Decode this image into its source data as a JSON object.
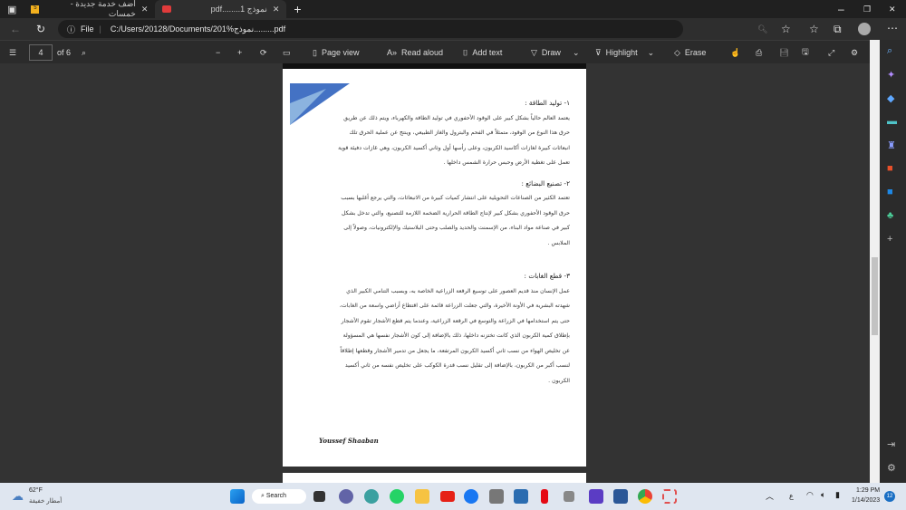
{
  "tabs": [
    {
      "label": "أضف خدمة جديدة - خمسات",
      "icon": "khamsat-icon"
    },
    {
      "label": "pdf........نموذج 1",
      "icon": "pdf-icon"
    }
  ],
  "address": {
    "scheme": "File",
    "url": "C:/Users/20128/Documents/201%نموذج.........pdf"
  },
  "pdf_toolbar": {
    "page": "4",
    "of": "of 6",
    "page_view": "Page view",
    "read_aloud": "Read aloud",
    "add_text": "Add text",
    "draw": "Draw",
    "highlight": "Highlight",
    "erase": "Erase"
  },
  "document": {
    "s1_title": "١- توليد الطاقة :",
    "s1_lines": [
      "يعتمد العالم حالياً بشكل كبير على الوقود الأحفوري في توليد الطاقة والكهرباء، ويتم ذلك عن طريق",
      "حرق هذا النوع من الوقود، متمثلاً في الفحم والبترول والغاز الطبيعي، وينتج عن عملية الحرق تلك",
      "انبعاثات كبيرة لغازات أكاسيد الكربون، وعلى رأسها أول وثاني أكسيد الكربون، وهي غازات دفيئة قوية",
      "تعمل على تغطية الأرض وحبس حرارة الشمس داخلها ."
    ],
    "s2_title": "٢- تصنيع البضائع :",
    "s2_lines": [
      "تعتمد الكثير من الصناعات التحويلية على انتشار كميات كبيرة من الانبعاثات، والتي يرجع أغلبها بسبب",
      "حرق الوقود الأحفوري بشكل كبير لإنتاج الطاقة الحرارية الضخمة اللازمة للتصنيع، والتي تدخل بشكل",
      "كبير في صناعة مواد البناء، من الإسمنت والحديد والصلب وحتى البلاستيك والإلكترونيات، وصولاً إلى",
      "الملابس ."
    ],
    "s3_title": "٣- قطع الغابات :",
    "s3_lines": [
      "عمل الإنسان منذ قديم العصور على توسيع الرقعة الزراعية الخاصة به، وبسبب التنامي الكبير الذي",
      "شهدته البشرية في الأونة الأخيرة، والتي جعلت الزراعة قائمة على اقتطاع أراضي واسعة من الغابات،",
      "حتى يتم استخدامها في الزراعة والتوسع في الرقعة الزراعية، وعندما يتم قطع الأشجار تقوم الأشجار",
      "بإطلاق كمية الكربون الذي كانت تختزنه داخلها، ذلك بالإضافة إلى كون الأشجار نفسها هي المسؤولة",
      "عن تخليص الهواء من نسب ثاني أكسيد الكربون المرتفعة، ما يجعل من تدمير الأشجار وقطعها إطلاقاً",
      "لنسب أكبر من الكربون، بالإضافة إلى تقليل نسب قدرة الكوكب على تخليص نفسه من ثاني أكسيد",
      "الكربون ."
    ],
    "signature": "Youssef Shaaban"
  },
  "taskbar": {
    "temp": "62°F",
    "weather": "أمطار خفيفة",
    "search": "Search",
    "lang": "ع",
    "time": "1:29 PM",
    "date": "1/14/2023",
    "badge": "12"
  }
}
